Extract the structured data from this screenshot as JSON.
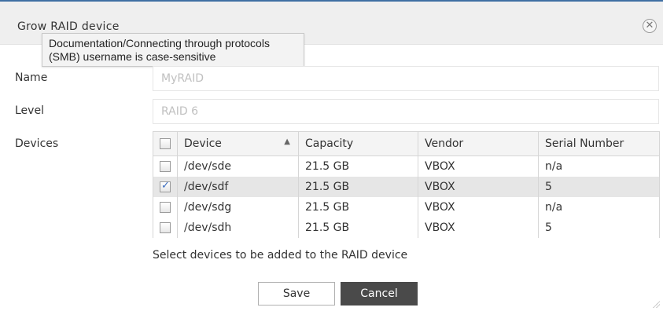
{
  "dialog": {
    "title": "Grow RAID device",
    "close_icon": "close-icon"
  },
  "tooltip": {
    "line1": "Documentation/Connecting through protocols",
    "line2": "(SMB) username is case-sensitive"
  },
  "form": {
    "name_label": "Name",
    "name_placeholder": "MyRAID",
    "level_label": "Level",
    "level_placeholder": "RAID 6",
    "devices_label": "Devices"
  },
  "table": {
    "columns": [
      "Device",
      "Capacity",
      "Vendor",
      "Serial Number"
    ],
    "sort_icon": "sort-ascending-icon",
    "rows": [
      {
        "device": "/dev/sde",
        "capacity": "21.5 GB",
        "vendor": "VBOX",
        "serial": "n/a",
        "checked": false
      },
      {
        "device": "/dev/sdf",
        "capacity": "21.5 GB",
        "vendor": "VBOX",
        "serial": "5",
        "checked": true
      },
      {
        "device": "/dev/sdg",
        "capacity": "21.5 GB",
        "vendor": "VBOX",
        "serial": "n/a",
        "checked": false
      },
      {
        "device": "/dev/sdh",
        "capacity": "21.5 GB",
        "vendor": "VBOX",
        "serial": "5",
        "checked": false
      }
    ]
  },
  "hint": "Select devices to be added to the RAID device",
  "buttons": {
    "save": "Save",
    "cancel": "Cancel"
  },
  "colors": {
    "accent": "#3f6fa3",
    "cancel_bg": "#4a4a4a",
    "selected_row": "#e6e6e6",
    "check": "#3b6cc0"
  }
}
